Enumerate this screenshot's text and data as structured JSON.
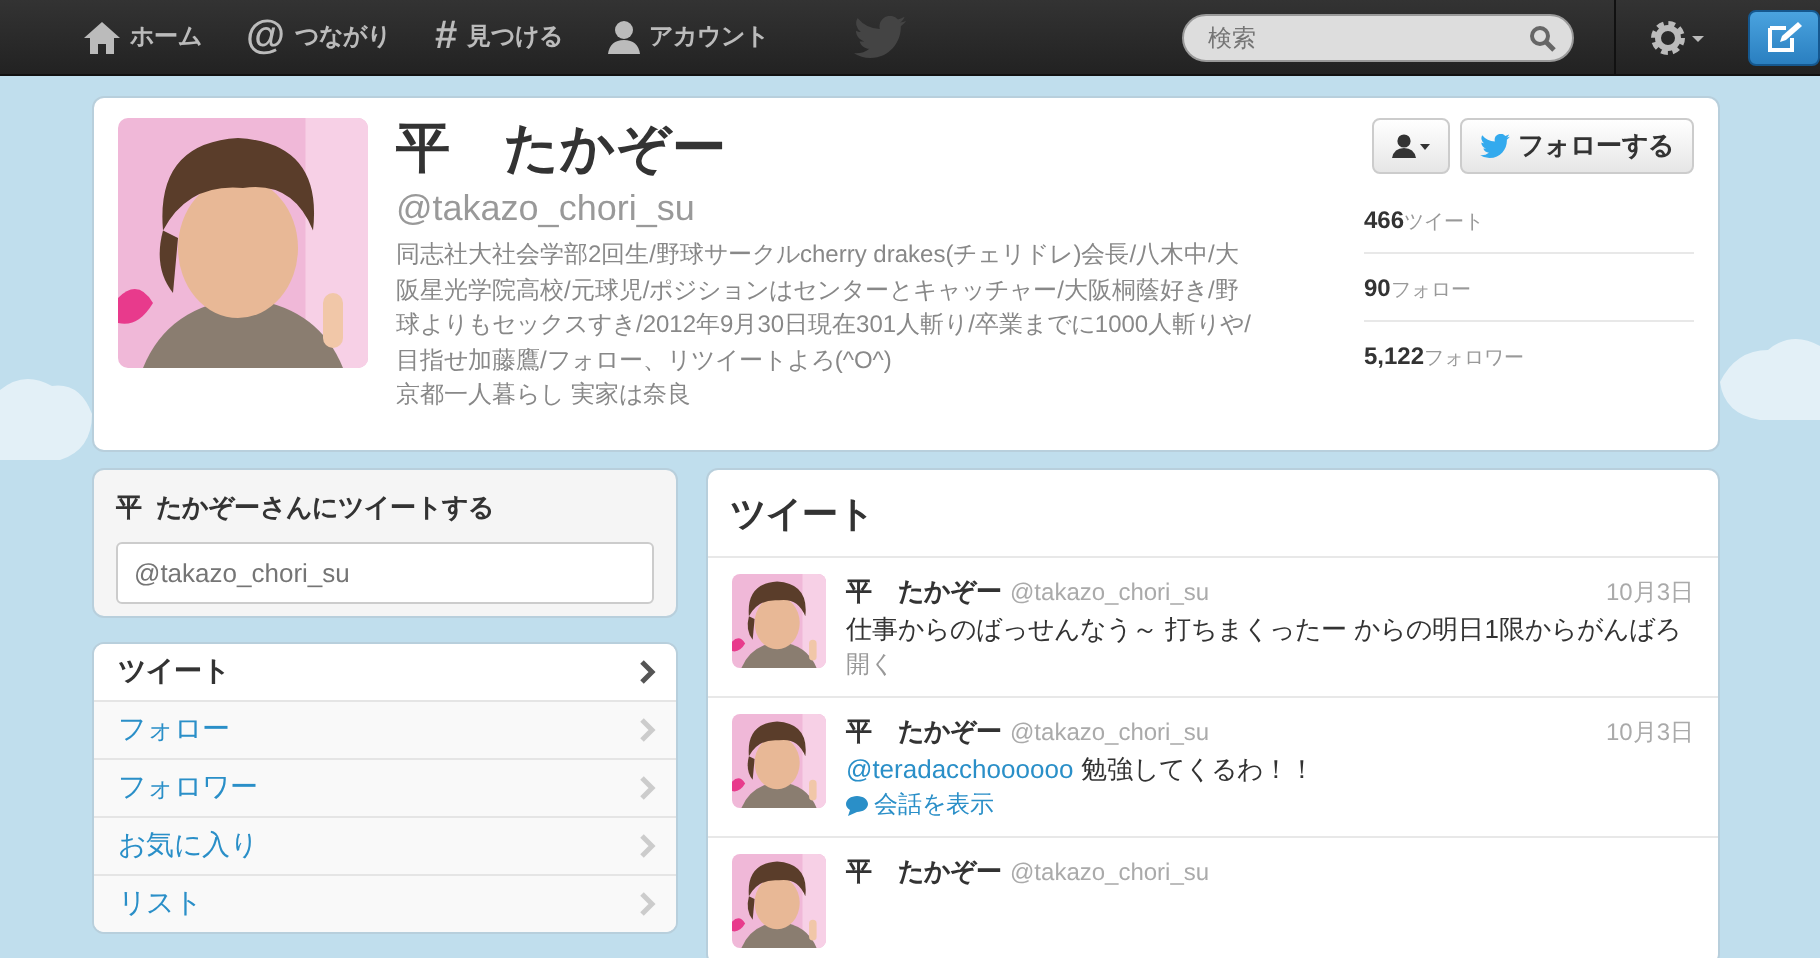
{
  "top_bar": {
    "nav": [
      {
        "kind": "home",
        "label": "ホーム"
      },
      {
        "kind": "glyph",
        "glyph": "@",
        "label": "つながり"
      },
      {
        "kind": "glyph",
        "glyph": "#",
        "label": "見つける"
      },
      {
        "kind": "account",
        "label": "アカウント"
      }
    ],
    "search": {
      "placeholder": "検索"
    }
  },
  "profile": {
    "name": "平　たかぞー",
    "handle": "@takazo_chori_su",
    "bio": "同志社大社会学部2回生/野球サークルcherry drakes(チェリドレ)会長/八木中/大阪星光学院高校/元球児/ポジションはセンターとキャッチャー/大阪桐蔭好き/野球よりもセックスすき/2012年9月30日現在301人斬り/卒業までに1000人斬りや/目指せ加藤鷹/フォロー、リツイートよろ(^O^)",
    "location": "京都一人暮らし 実家は奈良",
    "follow_button": "フォローする",
    "stats": [
      {
        "value": "466",
        "label": "ツイート"
      },
      {
        "value": "90",
        "label": "フォロー"
      },
      {
        "value": "5,122",
        "label": "フォロワー"
      }
    ]
  },
  "tweet_box": {
    "title": "平  たかぞーさんにツイートする",
    "placeholder": "@takazo_chori_su"
  },
  "side_nav": [
    {
      "label": "ツイート",
      "selected": true
    },
    {
      "label": "フォロー",
      "selected": false
    },
    {
      "label": "フォロワー",
      "selected": false
    },
    {
      "label": "お気に入り",
      "selected": false
    },
    {
      "label": "リスト",
      "selected": false
    }
  ],
  "timeline": {
    "title": "ツイート",
    "tweets": [
      {
        "name": "平　たかぞー",
        "handle": "@takazo_chori_su",
        "date": "10月3日",
        "text": "仕事からのばっせんなう～ 打ちまくったー からの明日1限からがんばろ",
        "action": {
          "kind": "expand",
          "label": "開く"
        }
      },
      {
        "name": "平　たかぞー",
        "handle": "@takazo_chori_su",
        "date": "10月3日",
        "mention": "@teradacchoooooo",
        "text": " 勉強してくるわ！！",
        "action": {
          "kind": "conversation",
          "label": "会話を表示"
        }
      },
      {
        "name": "平　たかぞー",
        "handle": "@takazo_chori_su"
      }
    ]
  }
}
